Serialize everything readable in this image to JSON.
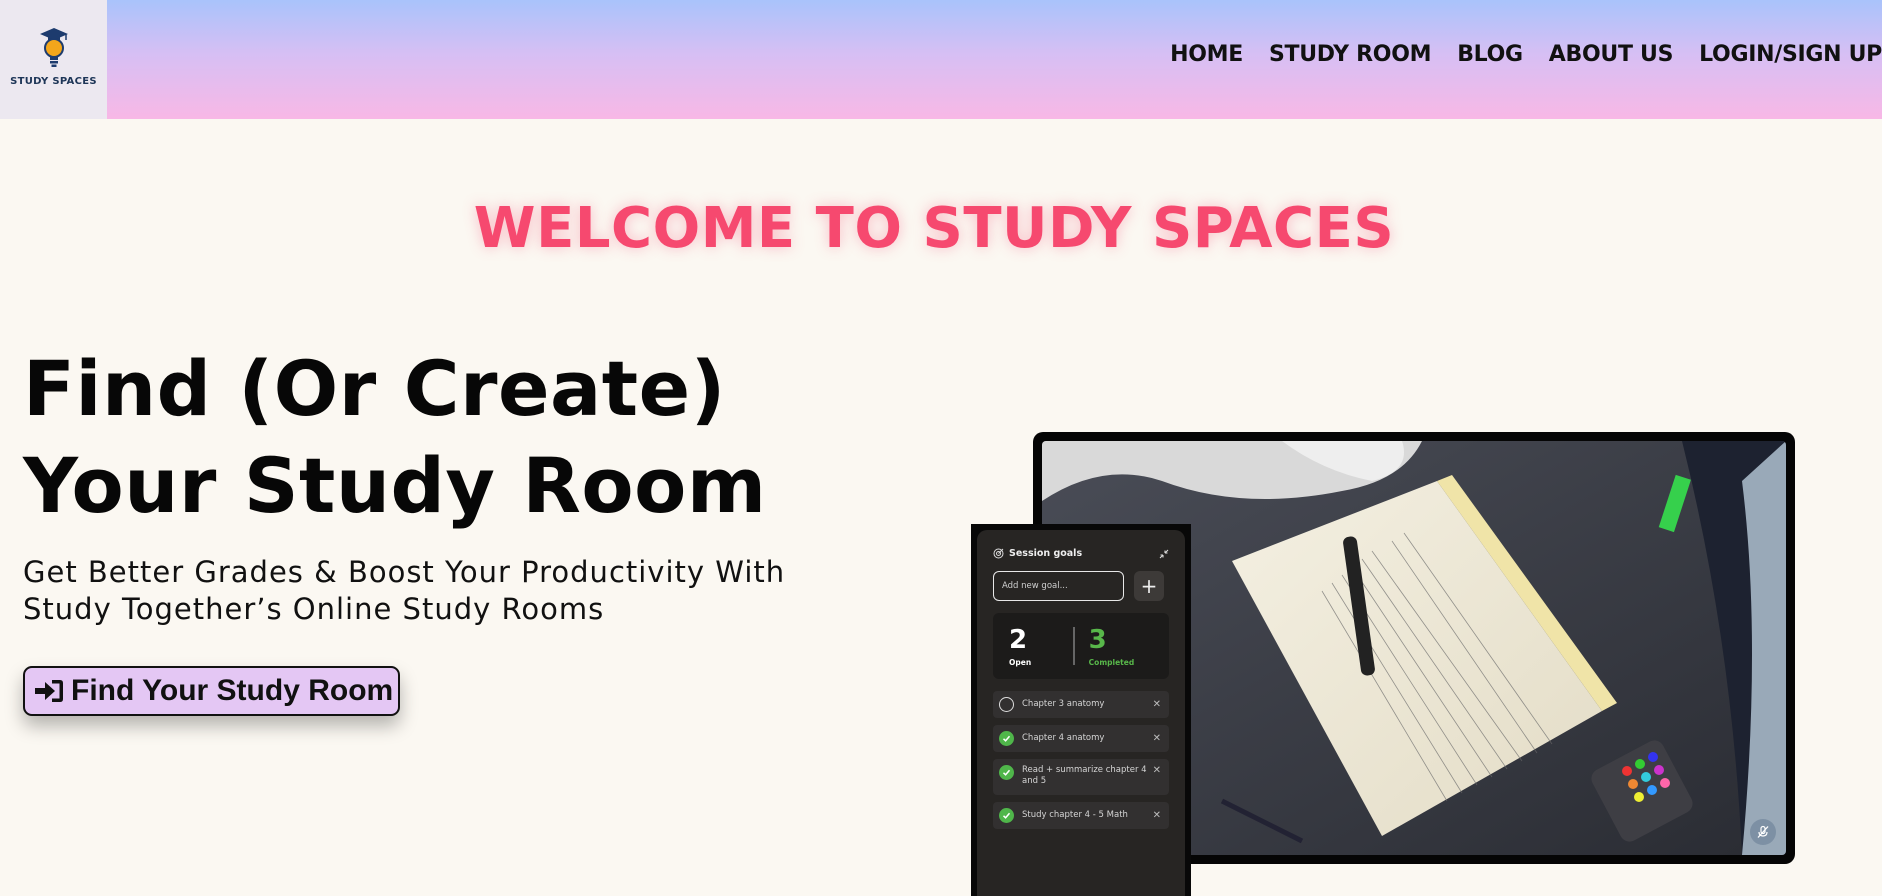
{
  "brand": {
    "name": "STUDY SPACES",
    "logo_icon": "lightbulb-graduation-icon"
  },
  "nav": {
    "items": [
      {
        "label": "HOME"
      },
      {
        "label": "STUDY ROOM"
      },
      {
        "label": "BLOG"
      },
      {
        "label": "ABOUT US"
      },
      {
        "label": "LOGIN/SIGN UP"
      }
    ]
  },
  "welcome": "WELCOME TO STUDY SPACES",
  "hero": {
    "title_line1": "Find (Or Create)",
    "title_line2": "Your Study Room",
    "subtitle_line1": "Get Better Grades & Boost Your Productivity With",
    "subtitle_line2": "Study Together’s Online Study Rooms",
    "cta_label": "Find Your Study Room",
    "cta_icon": "sign-in-arrow-icon"
  },
  "goals_panel": {
    "title": "Session goals",
    "input_placeholder": "Add new goal...",
    "add_symbol": "+",
    "open_count": "2",
    "open_label": "Open",
    "completed_count": "3",
    "completed_label": "Completed",
    "items": [
      {
        "label": "Chapter 3 anatomy",
        "done": false
      },
      {
        "label": "Chapter 4 anatomy",
        "done": true
      },
      {
        "label": "Read + summarize chapter 4 and 5",
        "done": true
      },
      {
        "label": "Study chapter 4 - 5 Math",
        "done": true
      }
    ]
  },
  "colors": {
    "accent_pink": "#f6496f",
    "cta_bg": "#e4c7f4",
    "completed_green": "#58b74a",
    "page_bg": "#fbf8f2"
  }
}
